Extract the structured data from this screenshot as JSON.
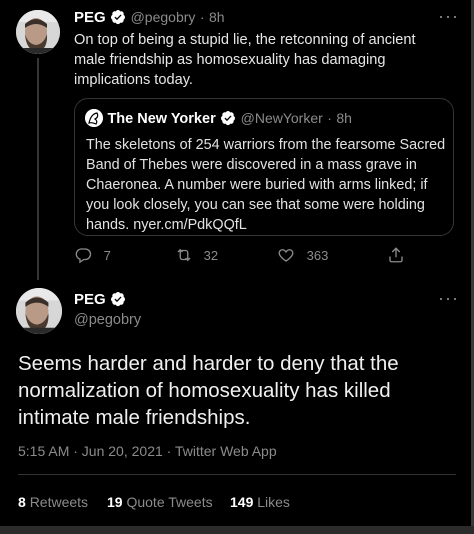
{
  "reply_tweet": {
    "author_name": "PEG",
    "handle": "@pegobry",
    "separator": "·",
    "time": "8h",
    "text": "On top of being a stupid lie, the retconning of ancient male friendship as homosexuality has damaging implications today.",
    "quoted": {
      "author_name": "The New Yorker",
      "handle": "@NewYorker",
      "separator": "·",
      "time": "8h",
      "text": "The skeletons of 254 warriors from the fearsome Sacred Band of Thebes were discovered in a mass grave in Chaeronea. A number were buried with arms linked; if you look closely, you can see that some were holding hands. nyer.cm/PdkQQfL"
    },
    "actions": {
      "replies": "7",
      "retweets": "32",
      "likes": "363"
    },
    "more_label": "···"
  },
  "main_tweet": {
    "author_name": "PEG",
    "handle": "@pegobry",
    "more_label": "···",
    "text": "Seems harder and harder to deny that the normalization of homosexuality has killed intimate male friendships.",
    "timestamp": "5:15 AM · Jun 20, 2021 · Twitter Web App",
    "stats": {
      "retweets_count": "8",
      "retweets_label": "Retweets",
      "quotes_count": "19",
      "quotes_label": "Quote Tweets",
      "likes_count": "149",
      "likes_label": "Likes"
    }
  },
  "colors": {
    "background": "#000000",
    "verified_badge": "#ffffff",
    "muted_text": "#8b8b8b"
  },
  "icons": [
    "verified-icon",
    "reply-icon",
    "retweet-icon",
    "like-icon",
    "share-icon",
    "more-icon"
  ]
}
